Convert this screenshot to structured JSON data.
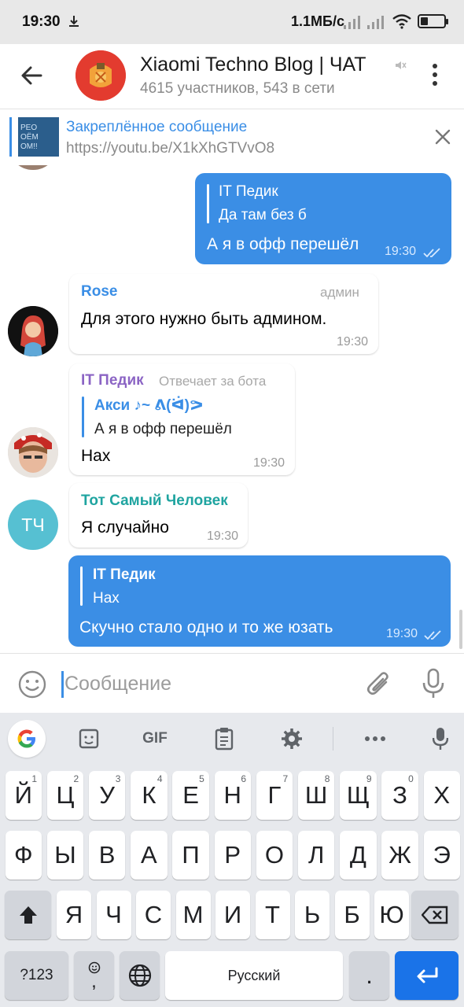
{
  "status_bar": {
    "time": "19:30",
    "network_speed": "1.1МБ/с"
  },
  "header": {
    "title": "Xiaomi Techno Blog | ЧАТ",
    "subtitle": "4615 участников, 543 в сети"
  },
  "pinned": {
    "title": "Закреплённое сообщение",
    "text": "https://youtu.be/X1kXhGTVvO8",
    "thumb_text": "РЕО ОЁМ ОМ!!"
  },
  "messages": [
    {
      "direction": "out",
      "reply_name": "IT Педик",
      "reply_text": "Да там без б",
      "text": "А я в офф перешёл",
      "time": "19:30"
    },
    {
      "direction": "in",
      "sender": "Rose",
      "badge": "админ",
      "text": "Для этого нужно быть админом.",
      "time": "19:30"
    },
    {
      "direction": "in",
      "sender": "IT Педик",
      "badge": "Отвечает за бота",
      "reply_name": "Акси ♪~ ᕕ(ᐛ)ᕗ",
      "reply_text": "А я в офф перешёл",
      "text": "Нах",
      "time": "19:30"
    },
    {
      "direction": "in",
      "sender": "Тот Самый Человек",
      "avatar_initials": "ТЧ",
      "text": "Я случайно",
      "time": "19:30"
    },
    {
      "direction": "out",
      "reply_name": "IT Педик",
      "reply_text": "Нах",
      "text": "Скучно стало одно и то же юзать",
      "time": "19:30"
    }
  ],
  "input": {
    "placeholder": "Сообщение"
  },
  "keyboard": {
    "toolbar": {
      "gif_label": "GIF"
    },
    "row1": [
      {
        "label": "Й",
        "hint": "1"
      },
      {
        "label": "Ц",
        "hint": "2"
      },
      {
        "label": "У",
        "hint": "3"
      },
      {
        "label": "К",
        "hint": "4"
      },
      {
        "label": "Е",
        "hint": "5"
      },
      {
        "label": "Н",
        "hint": "6"
      },
      {
        "label": "Г",
        "hint": "7"
      },
      {
        "label": "Ш",
        "hint": "8"
      },
      {
        "label": "Щ",
        "hint": "9"
      },
      {
        "label": "З",
        "hint": "0"
      },
      {
        "label": "Х",
        "hint": ""
      }
    ],
    "row2": [
      "Ф",
      "Ы",
      "В",
      "А",
      "П",
      "Р",
      "О",
      "Л",
      "Д",
      "Ж",
      "Э"
    ],
    "row3": [
      "Я",
      "Ч",
      "С",
      "М",
      "И",
      "Т",
      "Ь",
      "Б",
      "Ю"
    ],
    "symbols_label": "?123",
    "emoji_comma_label": ",",
    "space_label": "Русский",
    "period_label": "."
  },
  "colors": {
    "accent": "#3b8ee5",
    "outgoing_bubble": "#3b8ee5",
    "incoming_bubble": "#ffffff",
    "rose_name": "#3a8ee6",
    "it_name": "#8b64c4",
    "tch_name": "#1fa4a0",
    "tch_avatar": "#56c0d2",
    "enter_key": "#1a73e8"
  }
}
